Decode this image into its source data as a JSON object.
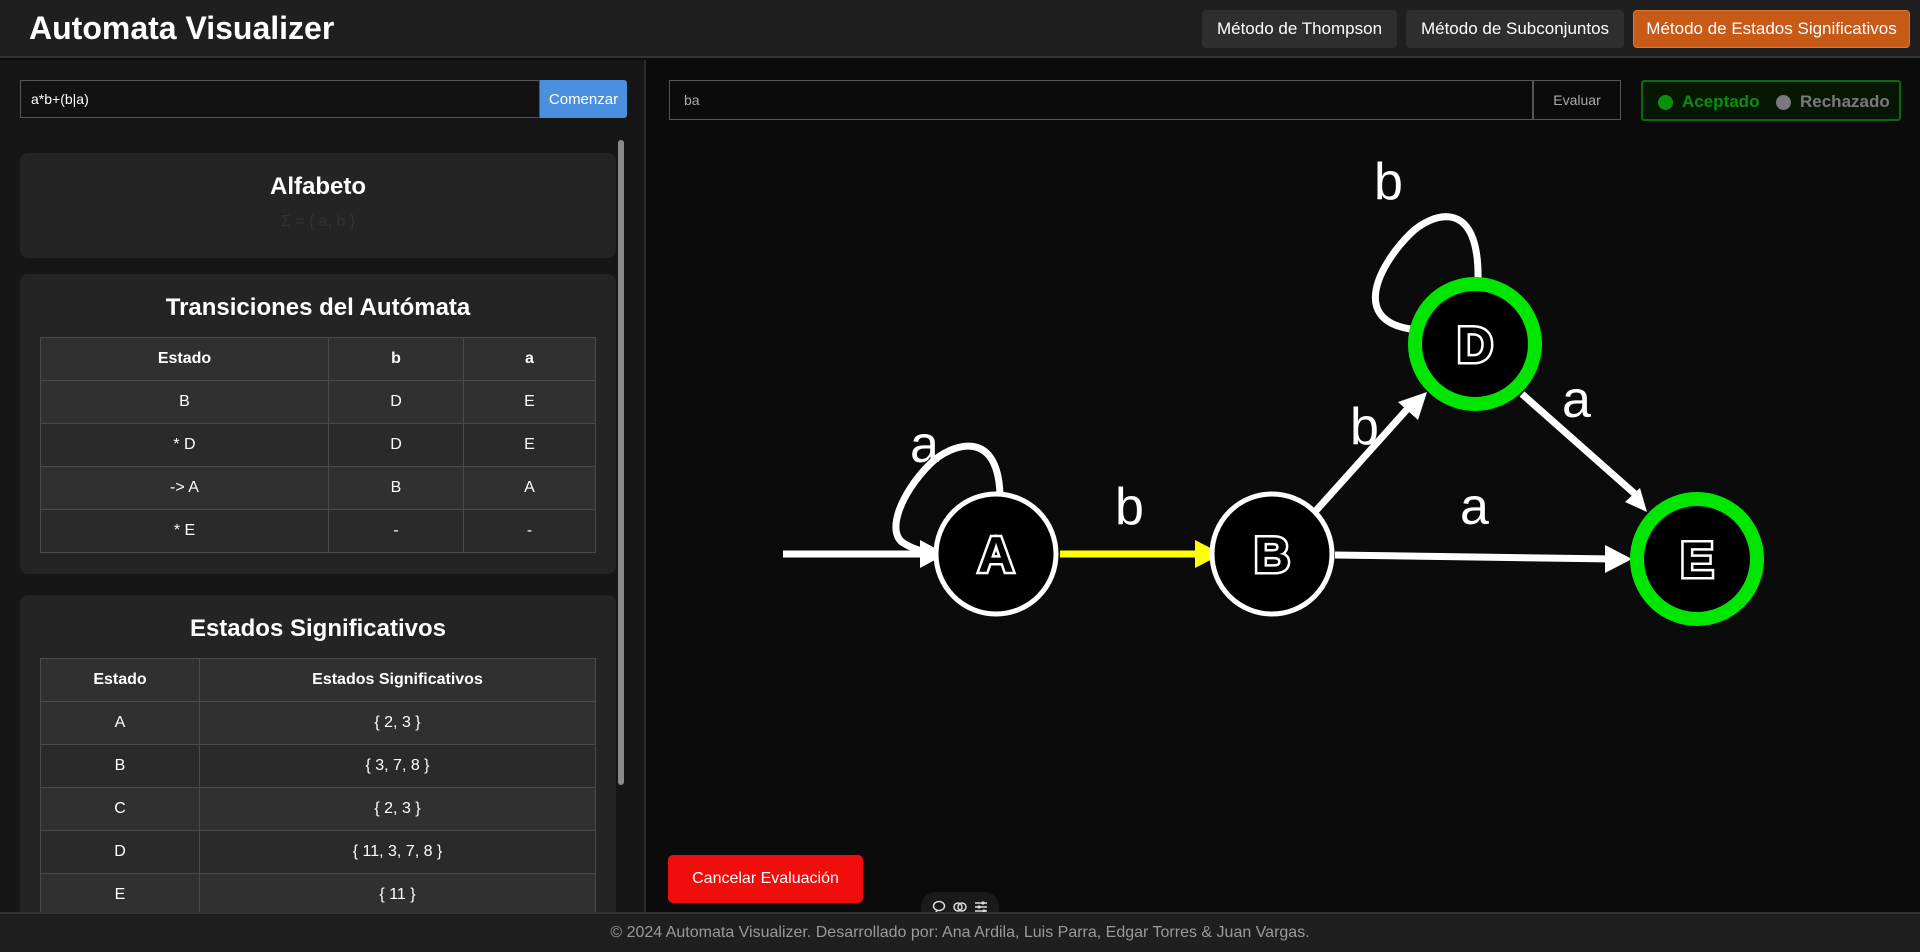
{
  "header": {
    "title": "Automata Visualizer",
    "nav": [
      {
        "label": "Método de Thompson",
        "active": false
      },
      {
        "label": "Método de Subconjuntos",
        "active": false
      },
      {
        "label": "Método de Estados Significativos",
        "active": true
      }
    ]
  },
  "left": {
    "regex_value": "a*b+(b|a)",
    "start_label": "Comenzar",
    "alphabet": {
      "title": "Alfabeto",
      "text": "Σ = { a, b }"
    },
    "transitions": {
      "title": "Transiciones del Autómata",
      "headers": [
        "Estado",
        "b",
        "a"
      ],
      "rows": [
        [
          "B",
          "D",
          "E"
        ],
        [
          "* D",
          "D",
          "E"
        ],
        [
          "-> A",
          "B",
          "A"
        ],
        [
          "* E",
          "-",
          "-"
        ]
      ]
    },
    "significant": {
      "title": "Estados Significativos",
      "headers": [
        "Estado",
        "Estados Significativos"
      ],
      "rows": [
        [
          "A",
          "{ 2, 3 }"
        ],
        [
          "B",
          "{ 3, 7, 8 }"
        ],
        [
          "C",
          "{ 2, 3 }"
        ],
        [
          "D",
          "{ 11, 3, 7, 8 }"
        ],
        [
          "E",
          "{ 11 }"
        ]
      ]
    }
  },
  "right": {
    "eval_value": "ba",
    "eval_label": "Evaluar",
    "accepted_label": "Aceptado",
    "rejected_label": "Rechazado",
    "cancel_label": "Cancelar Evaluación"
  },
  "automaton": {
    "states": [
      {
        "id": "A",
        "final": false,
        "initial": true
      },
      {
        "id": "B",
        "final": false,
        "initial": false
      },
      {
        "id": "D",
        "final": true,
        "initial": false
      },
      {
        "id": "E",
        "final": true,
        "initial": false
      }
    ],
    "transitions": [
      {
        "from": "A",
        "to": "A",
        "symbol": "a",
        "highlighted": false
      },
      {
        "from": "A",
        "to": "B",
        "symbol": "b",
        "highlighted": true
      },
      {
        "from": "B",
        "to": "D",
        "symbol": "b",
        "highlighted": false
      },
      {
        "from": "D",
        "to": "D",
        "symbol": "b",
        "highlighted": false
      },
      {
        "from": "D",
        "to": "E",
        "symbol": "a",
        "highlighted": false
      },
      {
        "from": "B",
        "to": "E",
        "symbol": "a",
        "highlighted": false
      }
    ]
  },
  "colors": {
    "accent": "#c75a17",
    "final_state": "#00e600",
    "highlight_edge": "#ffff00",
    "accepted": "#0b8f0b",
    "rejected": "#7a7a7a",
    "cancel": "#f20d0d",
    "start": "#4a8fe0"
  },
  "footer": {
    "text": "© 2024 Automata Visualizer. Desarrollado por: Ana Ardila, Luis Parra, Edgar Torres & Juan Vargas."
  }
}
